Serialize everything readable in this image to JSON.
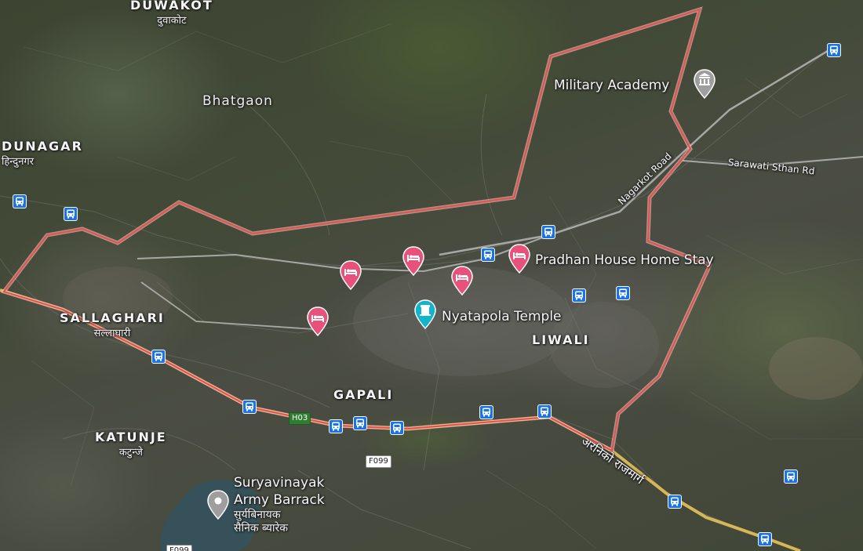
{
  "map": {
    "areas": [
      {
        "name": "DUWAKOT",
        "sub": "दुवाकोट"
      },
      {
        "name": "DUNAGAR",
        "sub": "हिन्दुनगर"
      },
      {
        "name": "SALLAGHARI",
        "sub": "सल्लाघारी"
      },
      {
        "name": "KATUNJE",
        "sub": "कटुन्जे"
      },
      {
        "name": "GAPALI",
        "sub": ""
      },
      {
        "name": "LIWALI",
        "sub": ""
      }
    ],
    "localities": [
      {
        "name": "Bhatgaon"
      }
    ],
    "places": [
      {
        "name": "Military Academy",
        "icon": "museum-icon",
        "color": "#9e9e9e"
      },
      {
        "name": "Pradhan House Home Stay",
        "icon": "hotel-icon",
        "color": "#e8517a"
      },
      {
        "name": "Nyatapola Temple",
        "icon": "temple-icon",
        "color": "#12b5cb"
      },
      {
        "name": "Suryavinayak Army Barrack",
        "line1": "Suryavinayak",
        "line2": "Army Barrack",
        "sub1": "सुर्यबिनायक",
        "sub2": "सैनिक ब्यारेक",
        "icon": "place-icon",
        "color": "#9e9e9e"
      }
    ],
    "roads": [
      {
        "name": "Nagarkot Road"
      },
      {
        "name": "Sarawati Sthan Rd"
      },
      {
        "name": "अरनिको राजमार्ग"
      }
    ],
    "shields": [
      {
        "label": "H03",
        "color": "#2e7d32"
      },
      {
        "label": "F099",
        "color": "#ffffff"
      },
      {
        "label": "F099",
        "color": "#ffffff"
      }
    ],
    "colors": {
      "boundary": "#e8524a",
      "highway": "#f0c04a",
      "hotel_pin": "#e8517a",
      "transit": "#1a73e8"
    }
  }
}
